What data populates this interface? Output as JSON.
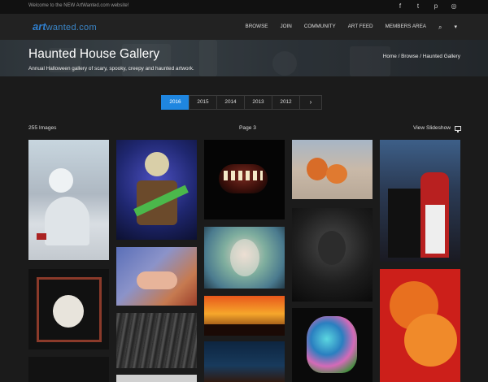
{
  "topbar": {
    "welcome": "Welcome to the NEW ArtWanted.com website!",
    "social_icons": [
      "facebook-icon",
      "twitter-icon",
      "pinterest-icon",
      "instagram-icon"
    ],
    "social_glyphs": [
      "f",
      "t",
      "p",
      "◎"
    ]
  },
  "logo": {
    "part1": "art",
    "part2": "wanted.com"
  },
  "nav": [
    "BROWSE",
    "JOIN",
    "COMMUNITY",
    "ART FEED",
    "MEMBERS AREA"
  ],
  "nav_icons": {
    "search": "⌕",
    "cart": "▾"
  },
  "hero": {
    "title": "Haunted House Gallery",
    "subtitle": "Annual Halloween gallery of scary, spooky, creepy and haunted artwork.",
    "breadcrumb": "Home / Browse / Haunted Gallery"
  },
  "pager": {
    "years": [
      "2016",
      "2015",
      "2014",
      "2013",
      "2012"
    ],
    "active": "2016",
    "next": "›"
  },
  "gallery": {
    "count": "255 Images",
    "page": "Page 3",
    "slideshow": "View Slideshow"
  },
  "colors": {
    "accent": "#1f86e0",
    "brand": "#2f7fd0",
    "background": "#1b1b1b"
  }
}
